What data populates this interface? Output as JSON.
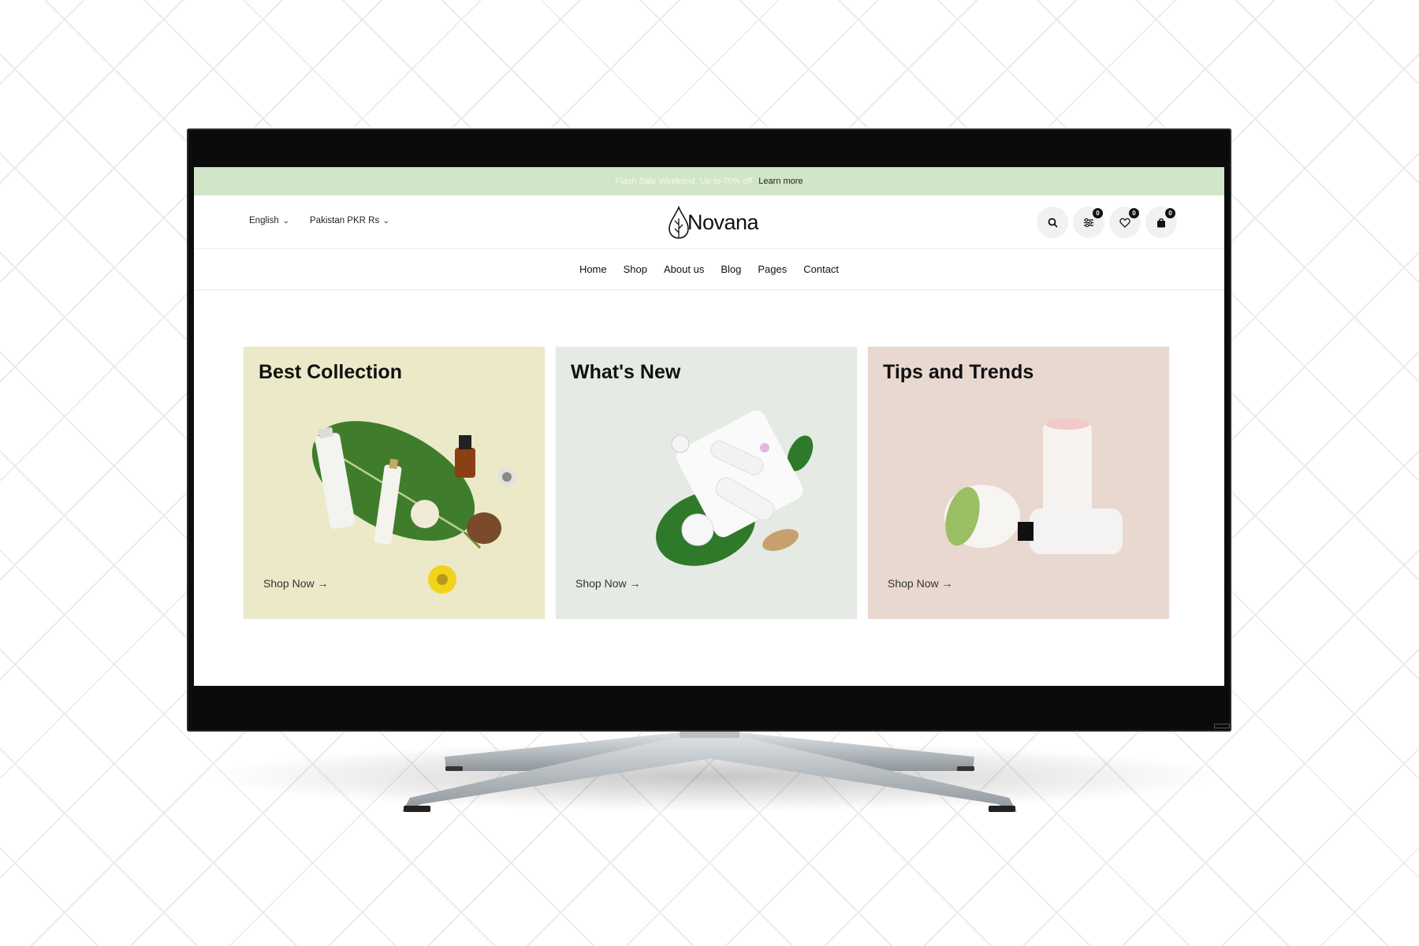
{
  "announcement": {
    "message": "Flash Sale Weekend. Up to 70% off",
    "link": "Learn more"
  },
  "header": {
    "language": "English",
    "currency": "Pakistan PKR Rs",
    "brand": "Novana",
    "compare_count": "0",
    "wishlist_count": "0",
    "cart_count": "0"
  },
  "nav": {
    "items": [
      {
        "label": "Home"
      },
      {
        "label": "Shop"
      },
      {
        "label": "About us"
      },
      {
        "label": "Blog"
      },
      {
        "label": "Pages"
      },
      {
        "label": "Contact"
      }
    ]
  },
  "cards": [
    {
      "title": "Best Collection",
      "cta": "Shop Now →",
      "bg": "#ebe9c8"
    },
    {
      "title": "What's New",
      "cta": "Shop Now →",
      "bg": "#e5eae5"
    },
    {
      "title": "Tips and Trends",
      "cta": "Shop Now →",
      "bg": "#e9d8cf"
    }
  ],
  "icons": {
    "search": "search-icon",
    "compare": "compare-icon",
    "wishlist": "heart-icon",
    "cart": "shopping-bag-icon"
  }
}
